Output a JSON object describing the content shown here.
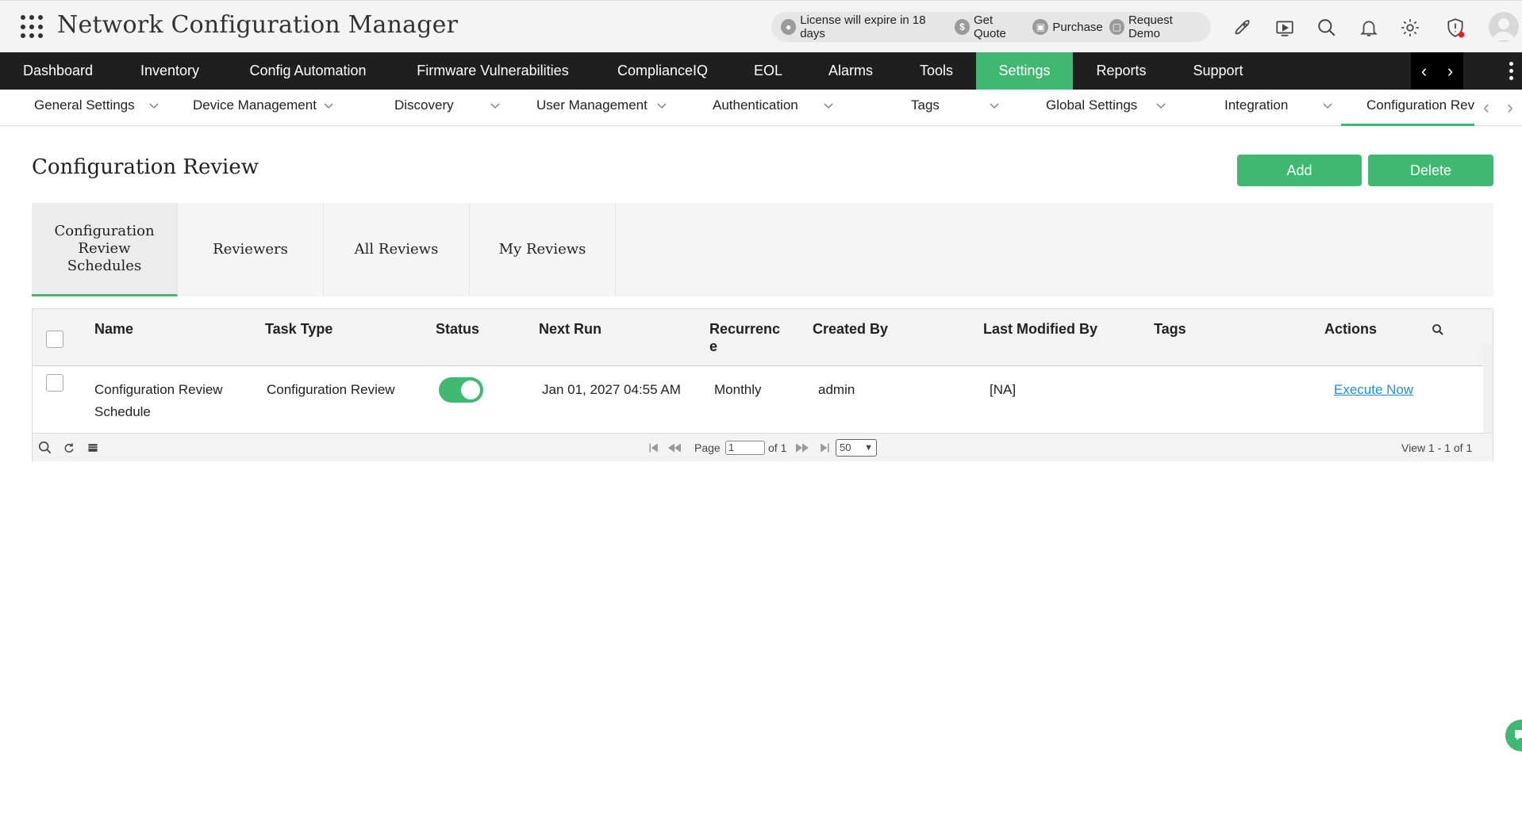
{
  "header": {
    "app_title": "Network Configuration Manager",
    "license_text": "License will expire in 18 days",
    "get_quote": "Get Quote",
    "purchase": "Purchase",
    "request_demo": "Request Demo"
  },
  "main_nav": {
    "items": [
      "Dashboard",
      "Inventory",
      "Config Automation",
      "Firmware Vulnerabilities",
      "ComplianceIQ",
      "EOL",
      "Alarms",
      "Tools",
      "Settings",
      "Reports",
      "Support"
    ],
    "active": "Settings"
  },
  "sub_nav": {
    "items": [
      "General Settings",
      "Device Management",
      "Discovery",
      "User Management",
      "Authentication",
      "Tags",
      "Global Settings",
      "Integration",
      "Configuration Rev"
    ],
    "active": "Configuration Rev"
  },
  "page": {
    "title": "Configuration Review",
    "add_label": "Add",
    "delete_label": "Delete"
  },
  "tabs": [
    "Configuration Review Schedules",
    "Reviewers",
    "All Reviews",
    "My Reviews"
  ],
  "table": {
    "columns": [
      "Name",
      "Task Type",
      "Status",
      "Next Run",
      "Recurrence",
      "Created By",
      "Last Modified By",
      "Tags",
      "Actions"
    ],
    "rows": [
      {
        "name": "Configuration Review Schedule",
        "task_type": "Configuration Review",
        "status_enabled": true,
        "next_run": "Jan 01, 2027 04:55 AM",
        "recurrence": "Monthly",
        "created_by": "admin",
        "last_modified_by": "[NA]",
        "tags": "",
        "action": "Execute Now"
      }
    ]
  },
  "pager": {
    "page_label": "Page",
    "page_value": "1",
    "of_label": "of 1",
    "page_size": "50",
    "view_text": "View 1 - 1 of 1"
  },
  "colors": {
    "accent": "#3fb871",
    "nav_bg": "#1f1f1f",
    "link": "#1f8fd8"
  }
}
